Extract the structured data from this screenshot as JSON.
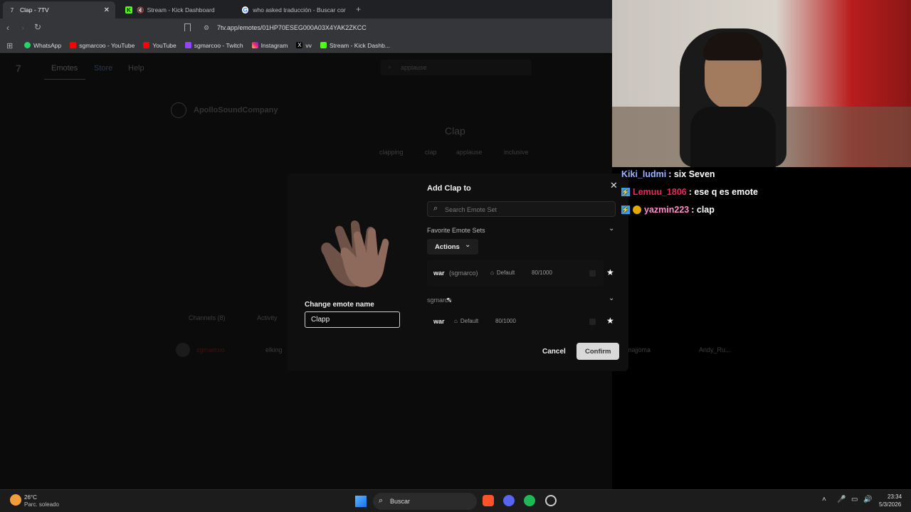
{
  "browser": {
    "tabs": [
      {
        "title": "Clap - 7TV",
        "active": true
      },
      {
        "title": "Stream - Kick Dashboard",
        "active": false
      },
      {
        "title": "who asked traducción - Buscar con G",
        "active": false
      }
    ],
    "url": "7tv.app/emotes/01HP70ESEG000A03X4YAK2ZKCC",
    "bookmarks": [
      "WhatsApp",
      "sgmarcoo - YouTube",
      "YouTube",
      "sgmarcoo - Twitch",
      "Instagram",
      "vv",
      "Stream - Kick Dashb..."
    ]
  },
  "site": {
    "nav": [
      "Emotes",
      "Store",
      "Help"
    ],
    "search_placeholder": "applause",
    "owner": "ApolloSoundCompany",
    "emote_title": "Clap",
    "tags": [
      "clapping",
      "clap",
      "applause",
      "inclusive"
    ],
    "channels_tab": "Channels (8)",
    "activity_tab": "Activity",
    "channels": [
      "sgmarcoo",
      "elking",
      "majjoma",
      "Andy_Ru..."
    ]
  },
  "dialog": {
    "title": "Add Clap to",
    "search_placeholder": "Search Emote Set",
    "favorites_label": "Favorite Emote Sets",
    "actions_label": "Actions",
    "change_name_label": "Change emote name",
    "name_value": "Clapp",
    "favorite_set": {
      "name": "war",
      "owner": "(sgmarco)",
      "badge": "Default",
      "count": "80/1000"
    },
    "group_label": "sgmarco",
    "group_set": {
      "name": "war",
      "badge": "Default",
      "count": "80/1000"
    },
    "cancel": "Cancel",
    "confirm": "Confirm"
  },
  "chat": [
    {
      "user": "Kiki_ludmi",
      "user_color": "#9fb4ff",
      "message": ": six Seven"
    },
    {
      "user": "Lemuu_1806",
      "user_color": "#e8285a",
      "message": ": ese q es emote"
    },
    {
      "user": "yazmin223",
      "user_color": "#ff8fc8",
      "message": ": clap"
    }
  ],
  "taskbar": {
    "temp": "26°C",
    "weather": "Parc. soleado",
    "search": "Buscar",
    "time": "23:34",
    "date": "5/3/2026"
  },
  "colors": {
    "accent_red": "#e8285a",
    "confirm_bg": "#d9d9d9"
  }
}
